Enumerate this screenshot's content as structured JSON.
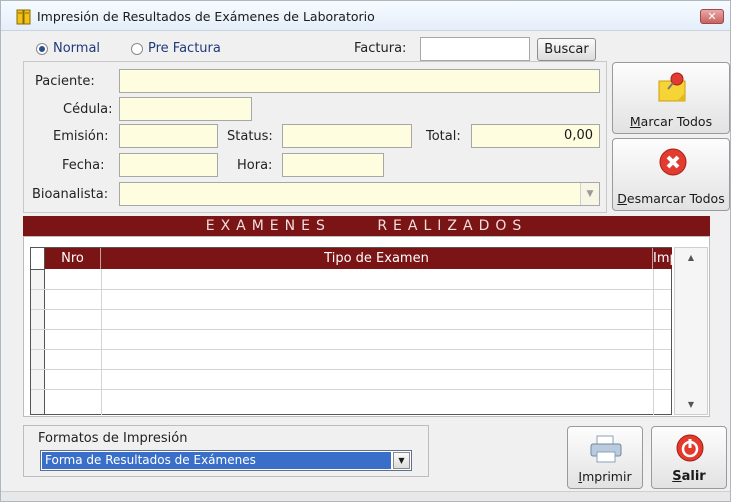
{
  "window": {
    "title": "Impresión de Resultados de Exámenes de Laboratorio",
    "close_label": "✕"
  },
  "mode": {
    "options": [
      {
        "label": "Normal",
        "selected": true
      },
      {
        "label": "Pre Factura",
        "selected": false
      }
    ]
  },
  "factura": {
    "label": "Factura:",
    "value": "",
    "search_label": "Buscar"
  },
  "patient": {
    "paciente_label": "Paciente:",
    "paciente_value": "",
    "cedula_label": "Cédula:",
    "cedula_value": "",
    "emision_label": "Emisión:",
    "emision_value": "",
    "status_label": "Status:",
    "status_value": "",
    "total_label": "Total:",
    "total_value": "0,00",
    "fecha_label": "Fecha:",
    "fecha_value": "",
    "hora_label": "Hora:",
    "hora_value": "",
    "bioanalista_label": "Bioanalista:",
    "bioanalista_value": ""
  },
  "actions": {
    "mark_all_first": "M",
    "mark_all_rest": "arcar Todos",
    "unmark_all_first": "D",
    "unmark_all_rest": "esmarcar Todos"
  },
  "exams": {
    "section_title_1": "EXAMENES",
    "section_title_2": "REALIZADOS",
    "columns": [
      "Nro",
      "Tipo de Examen",
      "Imp."
    ],
    "rows": []
  },
  "print_formats": {
    "label": "Formatos de Impresión",
    "selected": "Forma de Resultados de Exámenes"
  },
  "footer": {
    "print_first": "I",
    "print_rest": "mprimir",
    "exit_first": "S",
    "exit_rest": "alir"
  },
  "colors": {
    "header_accent": "#7b1414",
    "field_background": "#fffde0",
    "selection": "#3a6fc9"
  }
}
